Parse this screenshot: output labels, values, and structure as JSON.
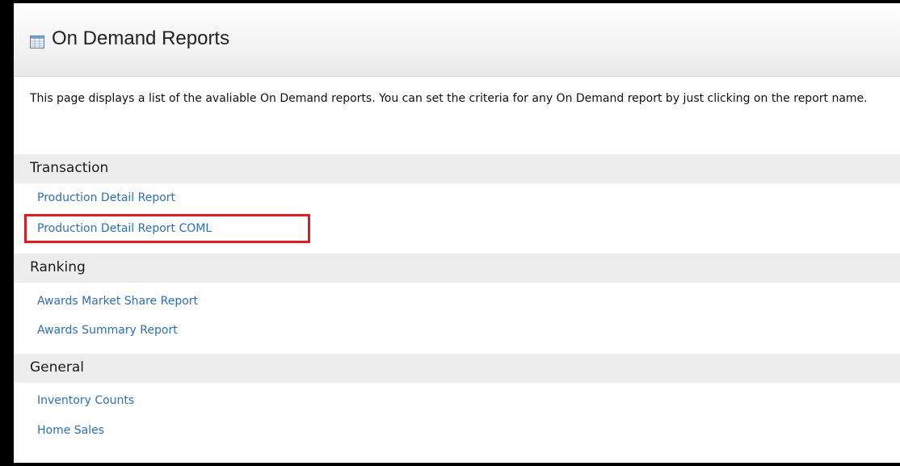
{
  "page": {
    "title": "On Demand Reports",
    "icon": "report-table-icon",
    "description": "This page displays a list of the avaliable On Demand reports. You can set the criteria for any On Demand report by just clicking on the report name."
  },
  "sections": [
    {
      "heading": "Transaction",
      "links": [
        "Production Detail Report",
        "Production Detail Report COML"
      ]
    },
    {
      "heading": "Ranking",
      "links": [
        "Awards Market Share Report",
        "Awards Summary Report"
      ]
    },
    {
      "heading": "General",
      "links": [
        "Inventory Counts",
        "Home Sales"
      ]
    }
  ],
  "colors": {
    "link": "#2d6fb5",
    "section_bg": "#ededed",
    "highlight": "#e01b24"
  }
}
